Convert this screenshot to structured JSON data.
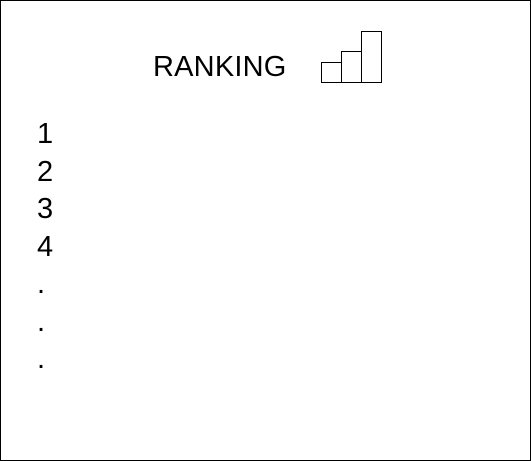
{
  "header": {
    "title": "RANKING",
    "icon": "bar-chart-icon"
  },
  "ranking": {
    "items": [
      "1",
      "2",
      "3",
      "4",
      ".",
      ".",
      "."
    ]
  },
  "colors": {
    "stroke": "#000000",
    "background": "#ffffff"
  }
}
